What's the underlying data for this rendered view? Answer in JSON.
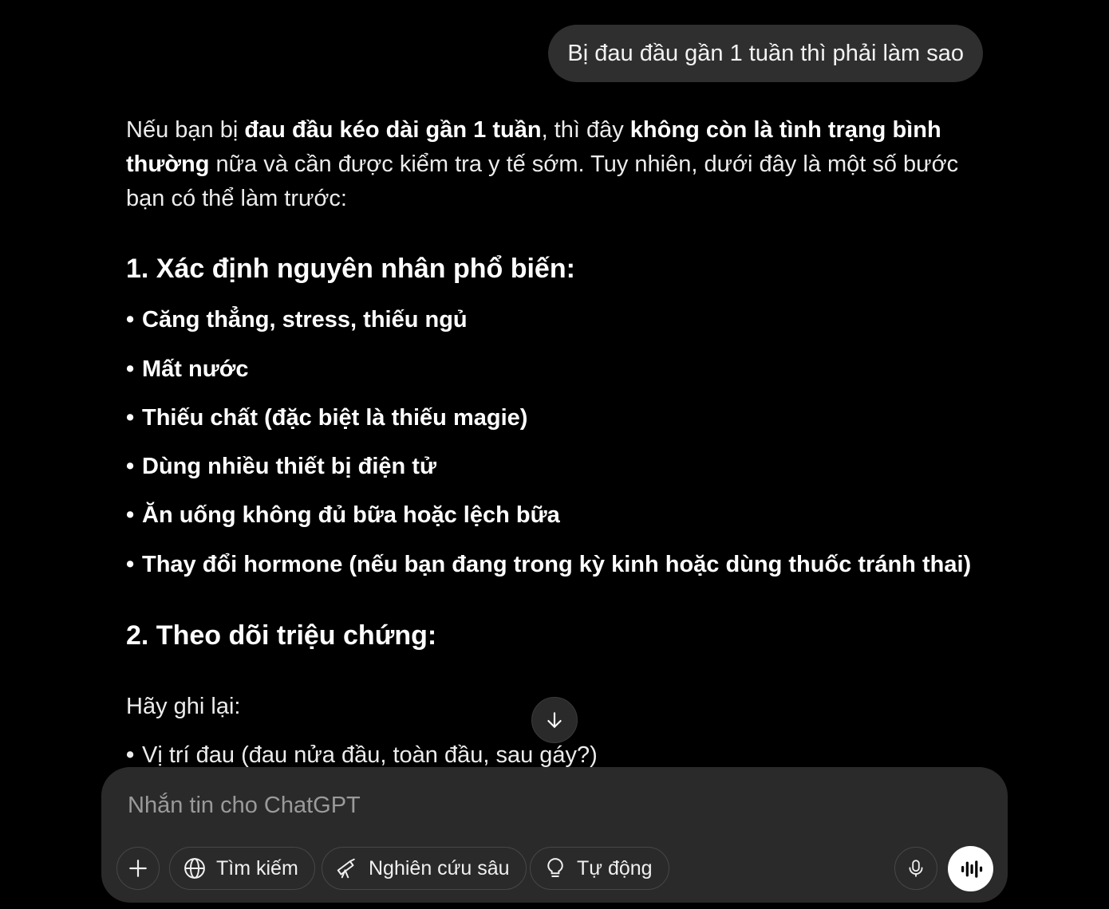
{
  "user_message": "Bị đau đầu gần 1 tuần thì phải làm sao",
  "reply": {
    "intro": {
      "p1": "Nếu bạn bị ",
      "b1": "đau đầu kéo dài gần 1 tuần",
      "p2": ", thì đây ",
      "b2": "không còn là tình trạng bình thường",
      "p3": " nữa và cần được kiểm tra y tế sớm. Tuy nhiên, dưới đây là một số bước bạn có thể làm trước:"
    },
    "section1": {
      "heading": "1. Xác định nguyên nhân phổ biến:",
      "items": [
        "Căng thẳng, stress, thiếu ngủ",
        "Mất nước",
        "Thiếu chất (đặc biệt là thiếu magie)",
        "Dùng nhiều thiết bị điện tử",
        "Ăn uống không đủ bữa hoặc lệch bữa",
        "Thay đổi hormone (nếu bạn đang trong kỳ kinh hoặc dùng thuốc tránh thai)"
      ]
    },
    "section2": {
      "heading": "2. Theo dõi triệu chứng:",
      "intro": "Hãy ghi lại:",
      "items": [
        "Vị trí đau (đau nửa đầu, toàn đầu, sau gáy?)"
      ]
    },
    "bullet_char": "•"
  },
  "composer": {
    "placeholder": "Nhắn tin cho ChatGPT",
    "tools": {
      "search": "Tìm kiếm",
      "deep_research": "Nghiên cứu sâu",
      "auto": "Tự động"
    },
    "icons": {
      "add": "plus-icon",
      "search": "globe-icon",
      "deep_research": "telescope-icon",
      "auto": "lightbulb-icon",
      "mic": "microphone-icon",
      "voice": "voice-waveform-icon"
    }
  },
  "colors": {
    "background": "#000000",
    "bubble": "#2f2f2f",
    "composer": "#2a2a2a",
    "text": "#ececec"
  }
}
